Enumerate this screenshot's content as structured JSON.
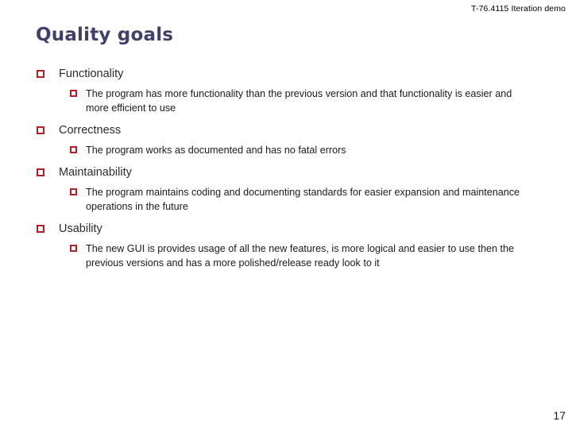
{
  "header": {
    "course_label": "T-76.4115 Iteration demo"
  },
  "title": "Quality goals",
  "bullets": [
    {
      "label": "Functionality",
      "sub": "The program has more functionality than the previous version and that functionality is easier and more efficient to use"
    },
    {
      "label": "Correctness",
      "sub": "The program works as documented and has no fatal errors"
    },
    {
      "label": "Maintainability",
      "sub": "The program maintains coding and documenting standards for easier expansion and maintenance operations in the future"
    },
    {
      "label": "Usability",
      "sub": "The new GUI is provides usage of all the new features, is more logical and easier to use then the previous versions and has a more polished/release ready look to it"
    }
  ],
  "footer": {
    "page_number": "17"
  },
  "colors": {
    "title": "#414069",
    "bullet_square": "#b51f24",
    "body_text": "#1a1a1a",
    "background": "#ffffff"
  }
}
